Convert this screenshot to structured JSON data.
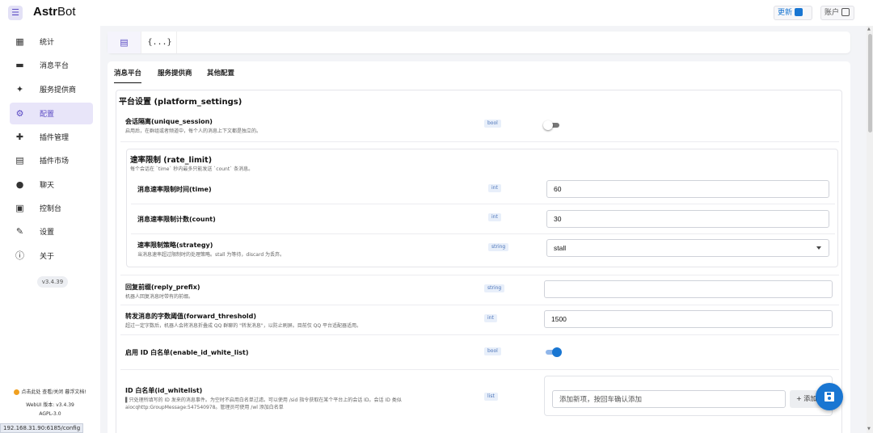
{
  "app": {
    "brand_bold": "Astr",
    "brand_rest": "Bot"
  },
  "topbar": {
    "update_label": "更新",
    "account_label": "账户"
  },
  "sidebar": {
    "items": [
      {
        "label": "统计",
        "icon": "dashboard-icon"
      },
      {
        "label": "消息平台",
        "icon": "message-icon"
      },
      {
        "label": "服务提供商",
        "icon": "sparkle-icon"
      },
      {
        "label": "配置",
        "icon": "gear-icon",
        "active": true
      },
      {
        "label": "插件管理",
        "icon": "puzzle-icon"
      },
      {
        "label": "插件市场",
        "icon": "store-icon"
      },
      {
        "label": "聊天",
        "icon": "chat-icon"
      },
      {
        "label": "控制台",
        "icon": "console-icon"
      },
      {
        "label": "设置",
        "icon": "wrench-icon"
      },
      {
        "label": "关于",
        "icon": "info-icon"
      }
    ],
    "version_chip": "v3.4.39",
    "footer_line1": "点击此处 查看/关闭 暮浮文档!",
    "footer_line2": "WebUI 版本: v3.4.39",
    "footer_line3": "AGPL-3.0",
    "status_url": "192.168.31.90:6185/config"
  },
  "toolbar": {
    "form_mode_icon": "form-icon",
    "json_mode_label": "{...}"
  },
  "tabs": [
    "消息平台",
    "服务提供商",
    "其他配置"
  ],
  "section": {
    "title": "平台设置 (platform_settings)",
    "unique_session": {
      "label": "会话隔离(unique_session)",
      "desc": "启用后，在群组或者频道中，每个人的消息上下文都是独立的。",
      "type": "bool",
      "enabled": false
    },
    "rate_limit": {
      "title": "速率限制 (rate_limit)",
      "desc": "每个会话在 `time` 秒内最多只能发送 `count` 条消息。",
      "time": {
        "label": "消息速率限制时间(time)",
        "type": "int",
        "value": "60"
      },
      "count": {
        "label": "消息速率限制计数(count)",
        "type": "int",
        "value": "30"
      },
      "strategy": {
        "label": "速率限制策略(strategy)",
        "desc": "当消息速率超过限制时的处理策略。stall 为等待，discard 为丢弃。",
        "type": "string",
        "value": "stall"
      }
    },
    "reply_prefix": {
      "label": "回复前缀(reply_prefix)",
      "desc": "机器人回复消息时带有的前缀。",
      "type": "string",
      "value": ""
    },
    "forward_threshold": {
      "label": "转发消息的字数阈值(forward_threshold)",
      "desc": "超过一定字数后，机器人会将消息折叠成 QQ 群聊的 \"转发消息\"，以防止刷屏。目前仅 QQ 平台适配器适用。",
      "type": "int",
      "value": "1500"
    },
    "enable_id_white_list": {
      "label": "启用 ID 白名单(enable_id_white_list)",
      "type": "bool",
      "enabled": true
    },
    "id_whitelist": {
      "label": "ID 白名单(id_whitelist)",
      "desc_line1": "▌只处理所填写的 ID 发来的消息事件。为空时不启用白名单过滤。可以使用 /sid 指令获取在某个平台上的会话 ID。会话 ID 类似",
      "desc_line2": "aiocqhttp:GroupMessage:547540978。管理员可使用 /wl 添加白名单",
      "type": "list",
      "placeholder": "添加新项，按回车确认添加",
      "add_label": "+ 添加"
    }
  },
  "fab": {
    "icon": "save-icon"
  },
  "colors": {
    "accent": "#5b4bc4",
    "primary": "#1976d2",
    "chip_bg": "#e8effa"
  }
}
